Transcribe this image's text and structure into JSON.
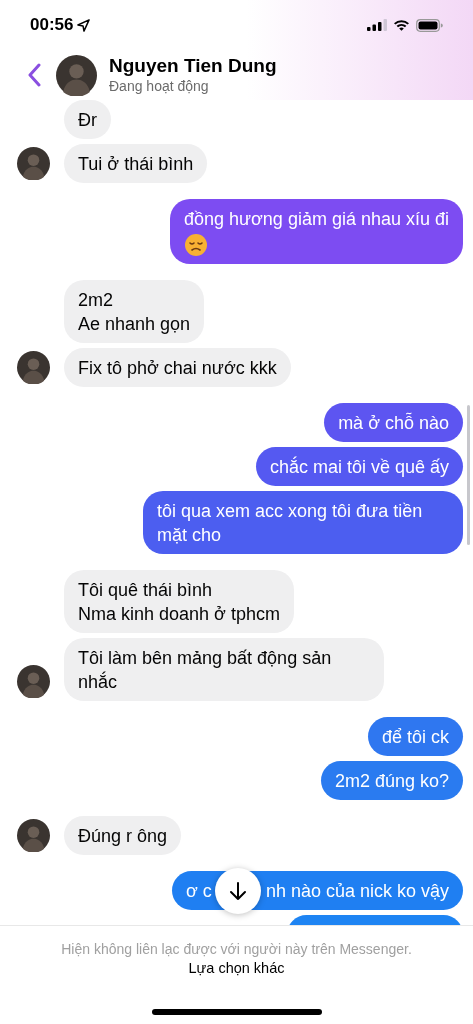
{
  "status_bar": {
    "time": "00:56"
  },
  "header": {
    "name": "Nguyen Tien Dung",
    "status": "Đang hoạt động"
  },
  "groups": [
    {
      "kind": "incoming",
      "messages": [
        {
          "text": "Đr"
        },
        {
          "text": "Tui ở thái bình"
        }
      ]
    },
    {
      "kind": "outgoing",
      "messages": [
        {
          "kind": "with_emoji",
          "text": "đồng hương giảm giá nhau xíu đi",
          "color": "#7d4cf2"
        }
      ]
    },
    {
      "kind": "incoming",
      "messages": [
        {
          "text": "2m2\nAe nhanh gọn"
        },
        {
          "text": "Fix tô phở chai nước kkk"
        }
      ]
    },
    {
      "kind": "outgoing",
      "messages": [
        {
          "text": "mà ở chỗ nào",
          "color": "#5d55f1"
        },
        {
          "text": "chắc mai tôi về quê ấy",
          "color": "#5559f1"
        },
        {
          "text": "tôi qua xem acc xong tôi đưa tiền mặt cho",
          "color": "#4c5ef0"
        }
      ]
    },
    {
      "kind": "incoming",
      "messages": [
        {
          "text": "Tôi quê thái bình\nNma kinh doanh ở tphcm"
        },
        {
          "text": "Tôi làm bên mảng bất động sản nhắc"
        }
      ]
    },
    {
      "kind": "outgoing",
      "messages": [
        {
          "text": "để tôi ck",
          "color": "#2f77f0"
        },
        {
          "text": "2m2 đúng ko?",
          "color": "#2a7bf0"
        }
      ]
    },
    {
      "kind": "incoming",
      "messages": [
        {
          "text": "Đúng r ông"
        }
      ]
    },
    {
      "kind": "outgoing",
      "messages": [
        {
          "text_parts": [
            "ơ c",
            "nh nào của nick ko vậy"
          ],
          "color": "#1f7ff2"
        },
        {
          "color": "#1e84f3"
        }
      ]
    }
  ],
  "footer": {
    "notice": "Hiện không liên lạc được với người này trên Messenger.",
    "action": "Lựa chọn khác"
  }
}
